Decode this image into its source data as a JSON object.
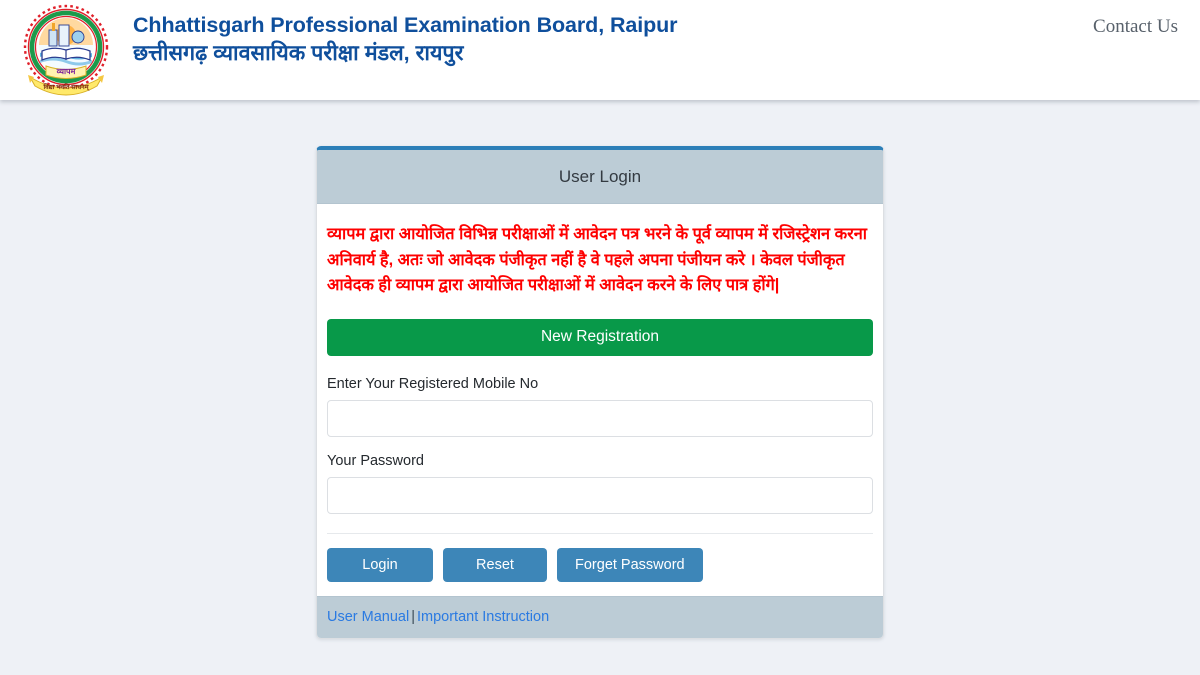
{
  "header": {
    "logo_icon": "cgvyapam-emblem-icon",
    "title_en": "Chhattisgarh Professional Examination Board, Raipur",
    "title_hi": "छत्तीसगढ़ व्यावसायिक परीक्षा मंडल, रायपुर",
    "contact_label": "Contact Us",
    "title_color": "#0f4f9c"
  },
  "login_card": {
    "header_title": "User Login",
    "header_bg": "#bcccd6",
    "accent_top_color": "#2c7fb8",
    "notice_hi": "व्यापम द्वारा आयोजित विभिन्न  परीक्षाओं में आवेदन पत्र भरने के पूर्व व्यापम में रजिस्ट्रेशन करना अनिवार्य है, अतः जो आवेदक पंजीकृत नहीं है वे पहले अपना  पंजीयन करे ।  केवल पंजीकृत आवेदक ही व्यापम द्वारा आयोजित परीक्षाओं में आवेदन करने के लिए पात्र होंगे|",
    "notice_color": "#fe0000",
    "register_button": {
      "label": "New Registration",
      "color": "#089949"
    },
    "fields": [
      {
        "label": "Enter Your Registered Mobile No",
        "value": "",
        "placeholder": ""
      },
      {
        "label": "Your Password",
        "value": "",
        "placeholder": ""
      }
    ],
    "actions": [
      {
        "label": "Login"
      },
      {
        "label": "Reset"
      },
      {
        "label": "Forget Password"
      }
    ],
    "action_color": "#3d86b8",
    "footer": {
      "user_manual_label": "User Manual",
      "separator": "|",
      "important_instruction_label": "Important Instruction",
      "link_color": "#2a7ae2"
    }
  },
  "page": {
    "background": "#eef1f6"
  }
}
